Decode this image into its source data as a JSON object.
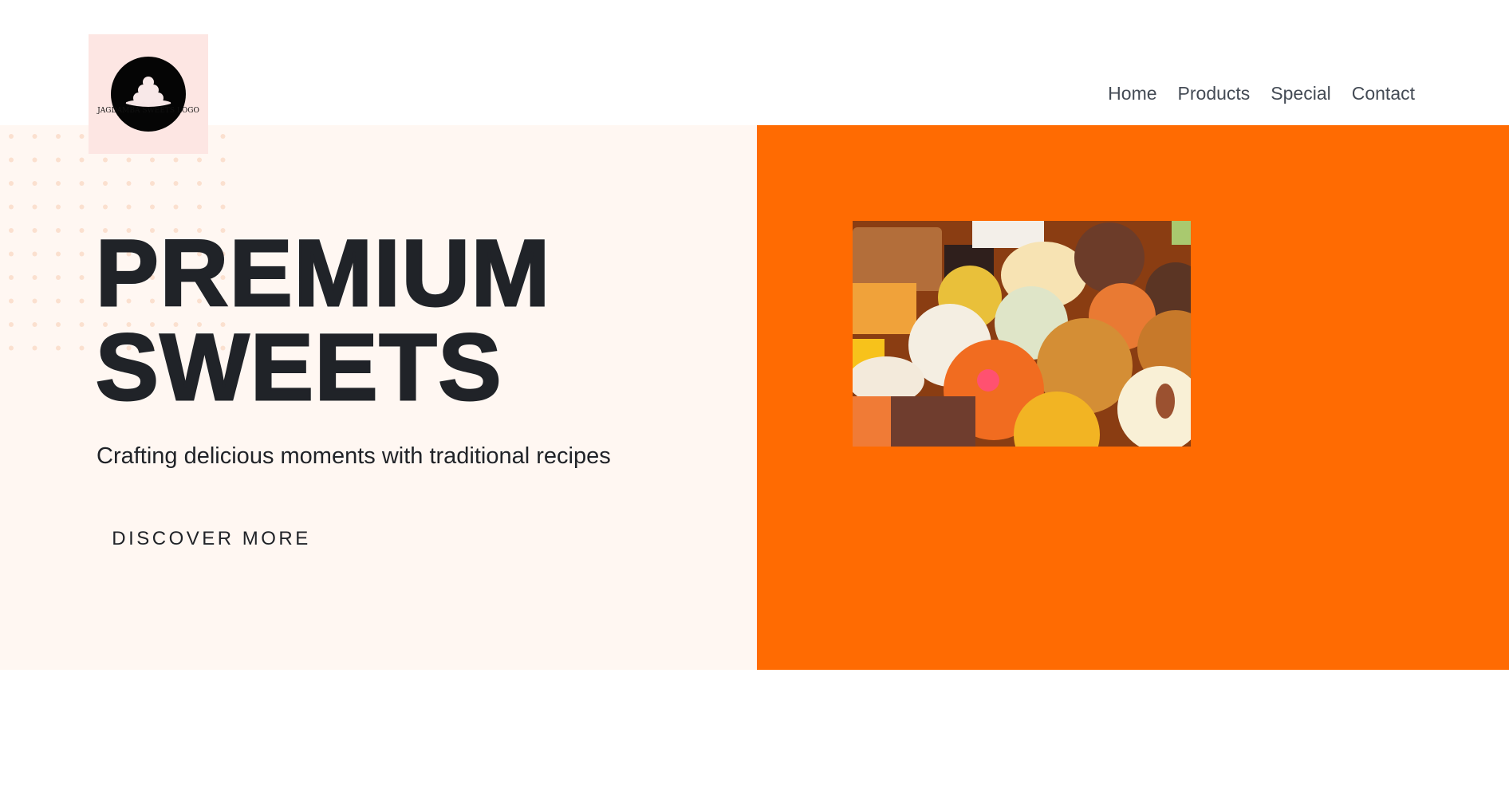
{
  "brand": {
    "logo_text": "JAGDAMBA SWEETS LOGO",
    "logo_bg": "#fde6e3"
  },
  "nav": {
    "items": [
      {
        "label": "Home"
      },
      {
        "label": "Products"
      },
      {
        "label": "Special"
      },
      {
        "label": "Contact"
      }
    ]
  },
  "hero": {
    "title_line1": "PREMIUM",
    "title_line2": "SWEETS",
    "subtitle": "Crafting delicious moments with traditional recipes",
    "cta_label": "DISCOVER MORE",
    "image_icon": "sweets-photo",
    "left_bg": "#fff7f2",
    "right_bg": "#ff6b02",
    "accent_text": "#202328"
  }
}
